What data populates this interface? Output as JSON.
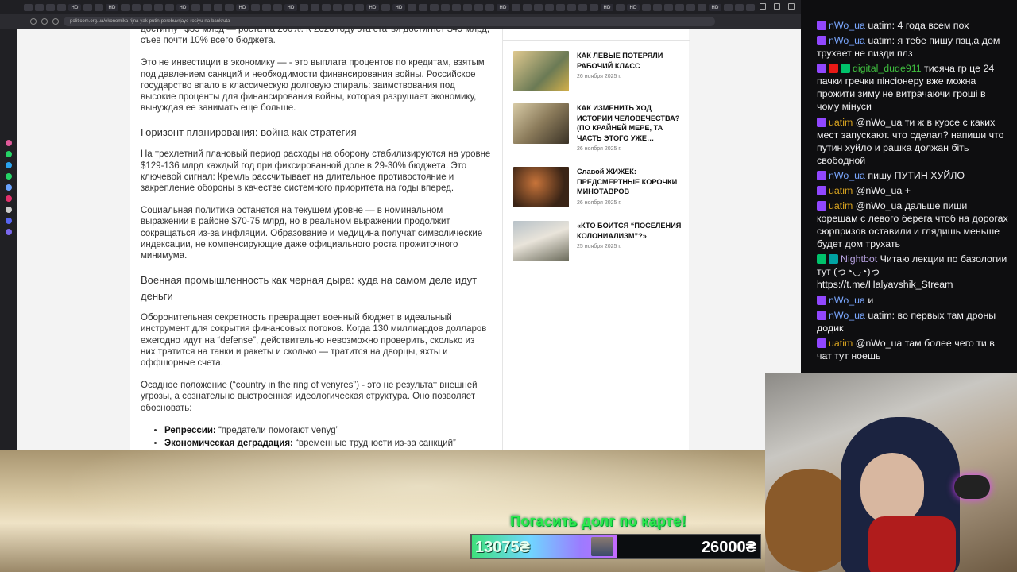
{
  "browser": {
    "url": "politicom.org.ua/ekonomika-rijna-yak-putin-perebuvrjaye-rosiyu-na-bankruta",
    "tab_label": "HD"
  },
  "article": {
    "intro_fragment": "достигнут $39 млрд — роста на 200%. К 2026 году эта статья достигнет $49 млрд, съев почти 10% всего бюджета.",
    "p1": "Это не инвестиции в экономику — - это выплата процентов по кредитам, взятым под давлением санкций и необходимости финансирования войны. Российское государство впало в классическую долговую спираль: заимствования под высокие проценты для финансирования войны, которая разрушает экономику, вынуждая ее занимать еще больше.",
    "h1": "Горизонт планирования: война как стратегия",
    "p2": "На трехлетний плановый период расходы на оборону стабилизируются на уровне $129-136 млрд каждый год при фиксированной доле в 29-30% бюджета. Это ключевой сигнал: Кремль рассчитывает на длительное противостояние и закрепление обороны в качестве системного приоритета на годы вперед.",
    "p3": "Социальная политика останется на текущем уровне — в номинальном выражении в районе $70-75 млрд, но в реальном выражении продолжит сокращаться из-за инфляции. Образование и медицина получат символические индексации, не компенсирующие даже официального роста прожиточного минимума.",
    "h2": "Военная промышленность как черная дыра: куда на самом деле идут деньги",
    "p4": "Оборонительная секретность превращает военный бюджет в идеальный инструмент для сокрытия финансовых потоков. Когда 130 миллиардов долларов ежегодно идут на “defense”, действительно невозможно проверить, сколько из них тратится на танки и ракеты и сколько — тратится на дворцы, яхты и оффшорные счета.",
    "p5": "Осадное положение (“country in the ring of venyres”) - это не результат внешней угрозы, а сознательно выстроенная идеологическая структура. Оно позволяет обосновать:",
    "bullets": [
      {
        "term": "Репрессии:",
        "text": " “предатели помогают venyg”"
      },
      {
        "term": "Экономическая деградация:",
        "text": " “временные трудности из-за санкций”"
      }
    ]
  },
  "related": [
    {
      "title": "КАК ЛЕВЫЕ ПОТЕРЯЛИ РАБОЧИЙ КЛАСС",
      "date": "26 ноября 2025 г.",
      "color": "#c9b489"
    },
    {
      "title": "КАК ИЗМЕНИТЬ ХОД ИСТОРИИ ЧЕЛОВЕЧЕСТВА? (ПО КРАЙНЕЙ МЕРЕ, ТА ЧАСТЬ ЭТОГО УЖЕ…",
      "date": "26 ноября 2025 г.",
      "color": "#b7a77f"
    },
    {
      "title": "Славой ЖИЖЕК: ПРЕДСМЕРТНЫЕ КОРОЧКИ МИНОТАВРОВ",
      "date": "26 ноября 2025 г.",
      "color": "#5a3a22"
    },
    {
      "title": "«КТО БОИТСЯ “ПОСЕЛЕНИЯ КОЛОНИАЛИЗМ”?»",
      "date": "25 ноября 2025 г.",
      "color": "#9aa4ac"
    }
  ],
  "chat": [
    {
      "user": "nWo_ua",
      "color": "#7aa7ff",
      "badges": [
        "purple"
      ],
      "text": "uatim: 4 года всем пох"
    },
    {
      "user": "nWo_ua",
      "color": "#7aa7ff",
      "badges": [
        "purple"
      ],
      "text": "uatim: я тебе пишу пзц,а дом трухает не пизди плз"
    },
    {
      "user": "digital_dude911",
      "color": "#3fbf3f",
      "badges": [
        "purple",
        "red",
        "green"
      ],
      "text": "тисяча гр це 24 пачки гречки пінсіонеру вже можна прожити зиму не витрачаючи гроші в чому мінуси"
    },
    {
      "user": "uatim",
      "color": "#daa520",
      "badges": [
        "purple"
      ],
      "text": "@nWo_ua ти ж в курсе с каких мест запускают. что сделал? напиши что путин хуйло и рашка должан біть свободной"
    },
    {
      "user": "nWo_ua",
      "color": "#7aa7ff",
      "badges": [
        "purple"
      ],
      "text": "пишу ПУТИН ХУЙЛО"
    },
    {
      "user": "uatim",
      "color": "#daa520",
      "badges": [
        "purple"
      ],
      "text": "@nWo_ua +"
    },
    {
      "user": "uatim",
      "color": "#daa520",
      "badges": [
        "purple"
      ],
      "text": "@nWo_ua дальше пиши корешам с левого берега чтоб на дорогах сюрпризов оставили и глядишь меньше будет дом трухать"
    },
    {
      "user": "Nightbot",
      "color": "#b9a3e3",
      "badges": [
        "green",
        "teal"
      ],
      "text": "Читаю лекции по базологии тут (っ◔◡◔)っ https://t.me/Halyavshik_Stream"
    },
    {
      "user": "nWo_ua",
      "color": "#7aa7ff",
      "badges": [
        "purple"
      ],
      "text": "и"
    },
    {
      "user": "nWo_ua",
      "color": "#7aa7ff",
      "badges": [
        "purple"
      ],
      "text": "uatim: во первых там дроны додик"
    },
    {
      "user": "uatim",
      "color": "#daa520",
      "badges": [
        "purple"
      ],
      "text": "@nWo_ua там более чего ти в чат тут ноешь"
    }
  ],
  "donation": {
    "title": "Погасить долг по карте!",
    "current": "13075₴",
    "goal": "26000₴",
    "progress": 0.503
  }
}
